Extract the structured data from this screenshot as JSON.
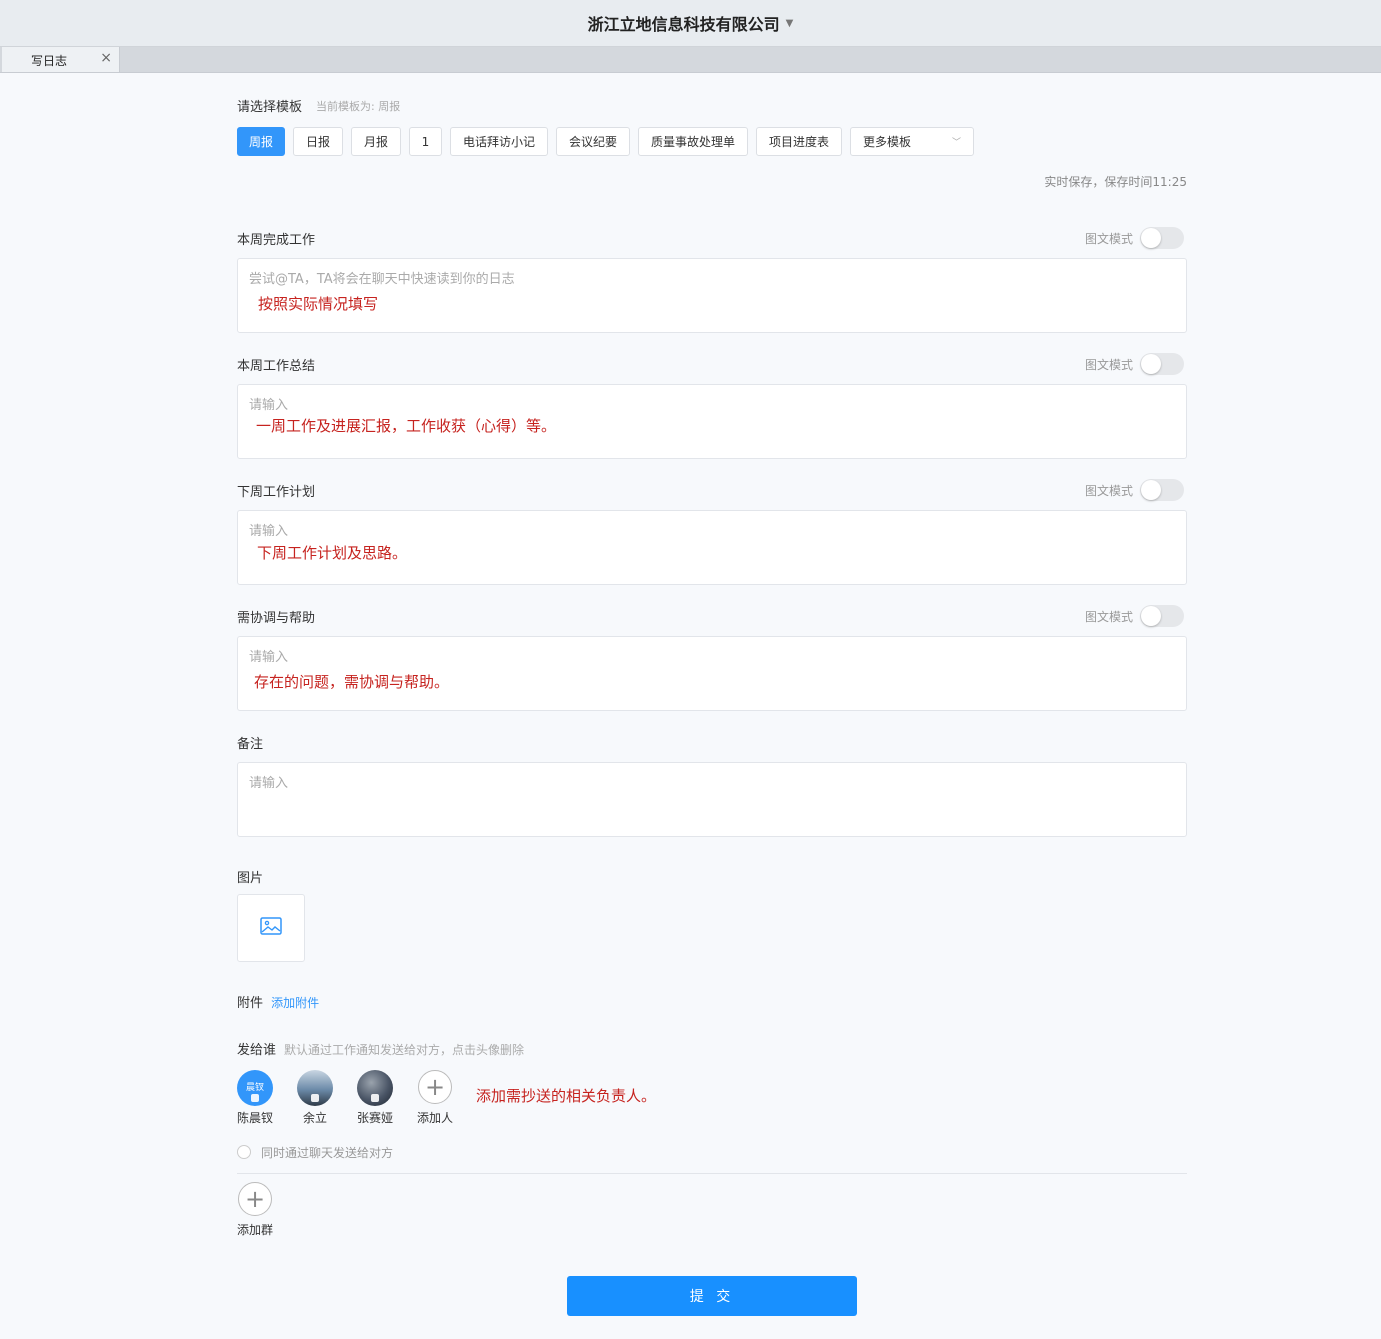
{
  "header": {
    "company": "浙江立地信息科技有限公司"
  },
  "tabs": [
    {
      "label": "写日志"
    }
  ],
  "template": {
    "title": "请选择模板",
    "current_hint": "当前模板为: 周报",
    "options": [
      "周报",
      "日报",
      "月报",
      "1",
      "电话拜访小记",
      "会议纪要",
      "质量事故处理单",
      "项目进度表"
    ],
    "active": "周报",
    "more_label": "更多模板"
  },
  "save_status": "实时保存，保存时间11:25",
  "mode_label": "图文模式",
  "sections": [
    {
      "label": "本周完成工作",
      "placeholder": "尝试@TA，TA将会在聊天中快速读到你的日志",
      "annotation": "按照实际情况填写",
      "mode_on": false
    },
    {
      "label": "本周工作总结",
      "placeholder": "请输入",
      "annotation": "一周工作及进展汇报，工作收获（心得）等。",
      "mode_on": false
    },
    {
      "label": "下周工作计划",
      "placeholder": "请输入",
      "annotation": "下周工作计划及思路。",
      "mode_on": false
    },
    {
      "label": "需协调与帮助",
      "placeholder": "请输入",
      "annotation": "存在的问题，需协调与帮助。",
      "mode_on": false
    },
    {
      "label": "备注",
      "placeholder": "请输入"
    }
  ],
  "images": {
    "label": "图片",
    "icon": "image-icon"
  },
  "attachment": {
    "label": "附件",
    "link": "添加附件"
  },
  "send": {
    "label": "发给谁",
    "hint": "默认通过工作通知发送给对方，点击头像删除",
    "recipients": [
      {
        "name": "陈晨钗",
        "avatar_text": "晨钗",
        "color": "#3296fa"
      },
      {
        "name": "余立",
        "color": "#6b8aa8"
      },
      {
        "name": "张赛娅",
        "color": "#4a5566"
      }
    ],
    "add_person": "添加人",
    "annotation": "添加需抄送的相关负责人。",
    "chat_option": "同时通过聊天发送给对方",
    "add_group": "添加群"
  },
  "submit_label": "提 交",
  "colors": {
    "primary": "#3296fa",
    "annotation": "#c6231f"
  }
}
